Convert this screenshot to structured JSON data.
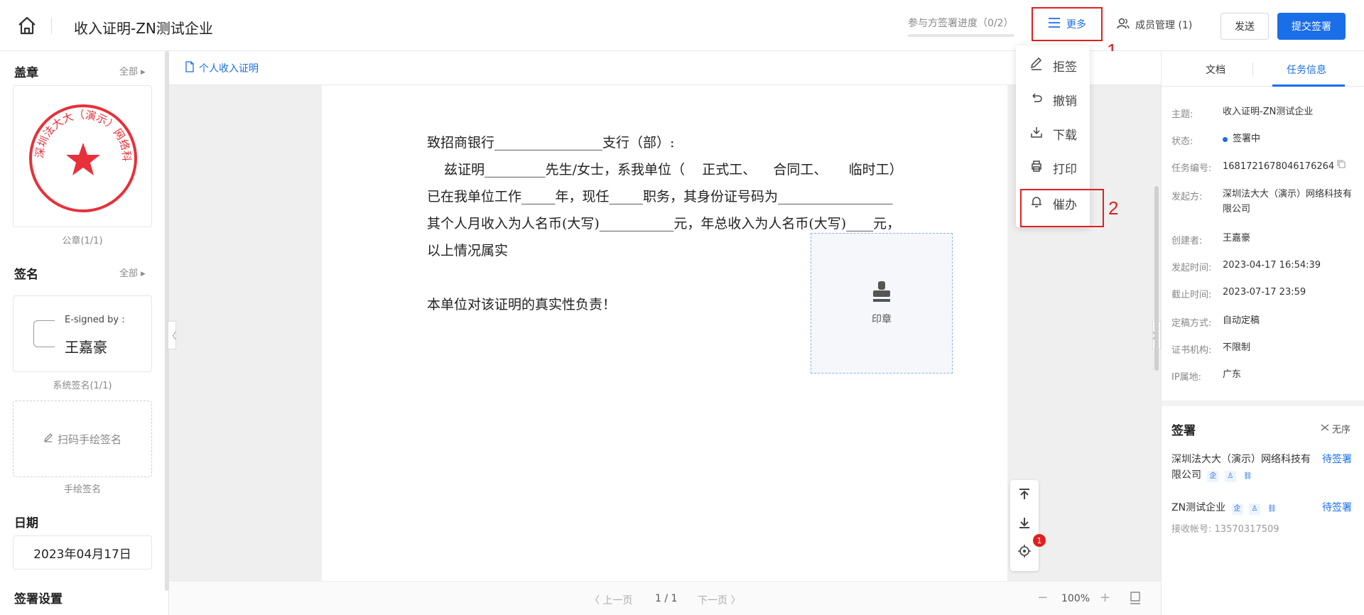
{
  "header": {
    "title": "收入证明-ZN测试企业",
    "progress_label": "参与方签署进度（0/2）",
    "progress_fraction": 0.0,
    "more_label": "更多",
    "member_label": "成员管理 (1)",
    "send_label": "发送",
    "submit_label": "提交签署",
    "annotation_1": "1",
    "annotation_2": "2"
  },
  "dropdown": {
    "items": [
      {
        "label": "拒签",
        "icon": "pen-icon"
      },
      {
        "label": "撤销",
        "icon": "undo-icon"
      },
      {
        "label": "下载",
        "icon": "download-icon"
      },
      {
        "label": "打印",
        "icon": "printer-icon"
      },
      {
        "label": "催办",
        "icon": "bell-icon"
      }
    ]
  },
  "left": {
    "seal_title": "盖章",
    "all_label": "全部",
    "seal_text": "深圳法大大（演示）网络科技有限公司",
    "seal_caption": "公章(1/1)",
    "sign_title": "签名",
    "esigned_by": "E-signed by :",
    "signer_name": "王嘉豪",
    "sys_sign_caption": "系统签名(1/1)",
    "scan_sign_label": "扫码手绘签名",
    "hand_sign_caption": "手绘签名",
    "date_title": "日期",
    "date_value": "2023年04月17日",
    "settings_title": "签署设置"
  },
  "doc": {
    "tab_label": "个人收入证明",
    "lines": [
      "致招商银行________________支行（部）:",
      "    兹证明_________先生/女士，系我单位（    正式工、    合同工、     临时工）",
      "已在我单位工作_____年，现任_____职务，其身份证号码为_________________",
      "其个人月收入为人名币(大写)___________元，年总收入为人名币(大写)____元，",
      "以上情况属实",
      "本单位对该证明的真实性负责！"
    ],
    "stamp_label": "印章",
    "badge_count": "1",
    "prev_page": "〈 上一页",
    "page_indicator": "1 / 1",
    "next_page": "下一页 〉",
    "zoom_minus": "−",
    "zoom": "100%",
    "zoom_plus": "+"
  },
  "right": {
    "tab_doc": "文档",
    "tab_task": "任务信息",
    "info": [
      {
        "label": "主题:",
        "value": "收入证明-ZN测试企业"
      },
      {
        "label": "状态:",
        "value": "签署中"
      },
      {
        "label": "任务编号:",
        "value": "1681721678046176264"
      },
      {
        "label": "发起方:",
        "value": "深圳法大大（演示）网络科技有限公司"
      },
      {
        "label": "创建者:",
        "value": "王嘉豪"
      },
      {
        "label": "发起时间:",
        "value": "2023-04-17 16:54:39"
      },
      {
        "label": "截止时间:",
        "value": "2023-07-17 23:59"
      },
      {
        "label": "定稿方式:",
        "value": "自动定稿"
      },
      {
        "label": "证书机构:",
        "value": "不限制"
      },
      {
        "label": "IP属地:",
        "value": "广东"
      }
    ],
    "sign_title": "签署",
    "order_label": "无序",
    "parties": [
      {
        "name_line1": "深圳法大大（演示）网络科技有",
        "name_line2": "限公司",
        "status": "待签署"
      },
      {
        "name_line1": "ZN测试企业",
        "name_line2": "",
        "status": "待签署",
        "account_label": "接收帐号:",
        "account": "13570317509"
      }
    ],
    "ico_ent": "企"
  },
  "colors": {
    "primary": "#1a6ee8",
    "annotation": "#e02020",
    "seal": "#e8303a"
  }
}
